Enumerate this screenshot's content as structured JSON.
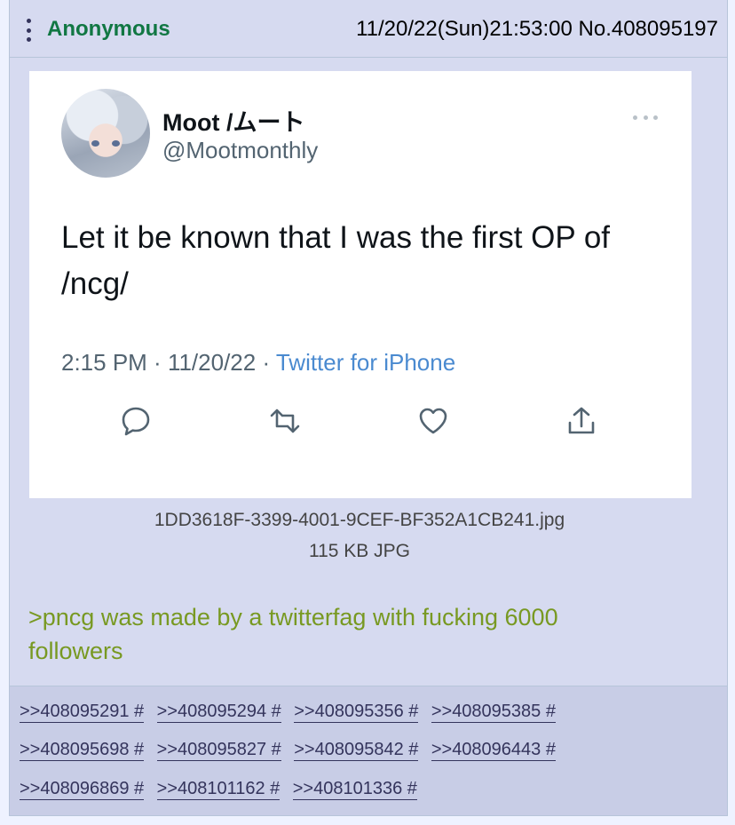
{
  "post": {
    "name": "Anonymous",
    "meta": "11/20/22(Sun)21:53:00 No.408095197",
    "tweet": {
      "display_name": "Moot /ムート",
      "handle": "@Mootmonthly",
      "text": "Let it be known that I was the first OP of /ncg/",
      "time": "2:15 PM",
      "date": "11/20/22",
      "source": "Twitter for iPhone",
      "actions": [
        "reply-icon",
        "retweet-icon",
        "like-icon",
        "share-icon"
      ]
    },
    "file": {
      "name": "1DD3618F-3399-4001-9CEF-BF352A1CB241.jpg",
      "size": "115 KB JPG"
    },
    "comment": ">pncg was made by a twitterfag with fucking 6000 followers",
    "backlinks": [
      [
        ">>408095291 #",
        ">>408095294 #",
        ">>408095356 #",
        ">>408095385 #"
      ],
      [
        ">>408095698 #",
        ">>408095827 #",
        ">>408095842 #",
        ">>408096443 #"
      ],
      [
        ">>408096869 #",
        ">>408101162 #",
        ">>408101336 #"
      ]
    ]
  },
  "colors": {
    "name": "#117743",
    "greentext": "#789922",
    "link": "#34345c",
    "post_bg": "#d6daf0"
  }
}
